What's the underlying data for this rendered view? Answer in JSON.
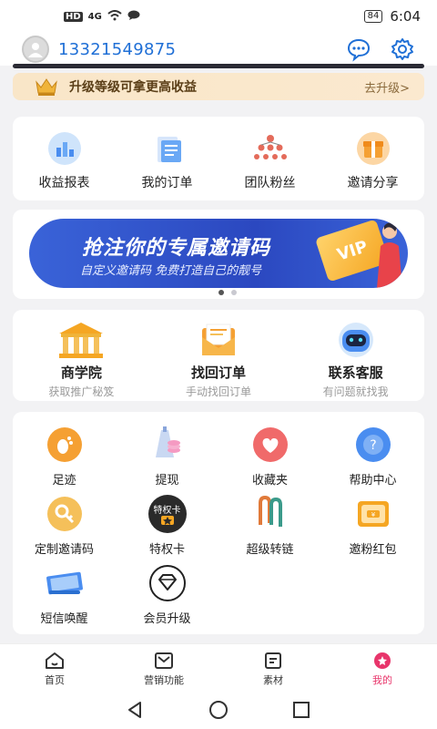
{
  "status_bar": {
    "left_icons": [
      "hd-icon",
      "4g-icon",
      "wifi-icon",
      "message-icon"
    ],
    "hd_text": "HD",
    "network_text": "4G",
    "battery": "84",
    "time": "6:04"
  },
  "header": {
    "phone": "13321549875",
    "icons": [
      "chat-icon",
      "settings-icon"
    ]
  },
  "upgrade_bar": {
    "text": "升级等级可拿更高收益",
    "action": "去升级>"
  },
  "quick_grid": {
    "items": [
      {
        "label": "收益报表",
        "icon": "report-icon"
      },
      {
        "label": "我的订单",
        "icon": "orders-icon"
      },
      {
        "label": "团队粉丝",
        "icon": "team-icon"
      },
      {
        "label": "邀请分享",
        "icon": "invite-gift-icon"
      }
    ]
  },
  "banner": {
    "title": "抢注你的专属邀请码",
    "subtitle": "自定义邀请码 免费打造自己的靓号",
    "badge": "VIP"
  },
  "services": {
    "items": [
      {
        "title": "商学院",
        "sub": "获取推广秘笈",
        "icon": "school-icon"
      },
      {
        "title": "找回订单",
        "sub": "手动找回订单",
        "icon": "envelope-icon"
      },
      {
        "title": "联系客服",
        "sub": "有问题就找我",
        "icon": "robot-icon"
      }
    ]
  },
  "tools": {
    "items": [
      {
        "label": "足迹",
        "icon": "footprint-icon",
        "color": "#f5a033"
      },
      {
        "label": "提现",
        "icon": "withdraw-icon",
        "color": "#a9c2ee"
      },
      {
        "label": "收藏夹",
        "icon": "favorites-icon",
        "color": "#f06a6a"
      },
      {
        "label": "帮助中心",
        "icon": "help-icon",
        "color": "#4a8df0"
      },
      {
        "label": "定制邀请码",
        "icon": "key-icon",
        "color": "#f5b13d"
      },
      {
        "label": "特权卡",
        "icon": "privilege-card-icon",
        "color": "#2a2a2a",
        "badge": "特权卡"
      },
      {
        "label": "超级转链",
        "icon": "paperclip-icon",
        "color": "#e07a3a"
      },
      {
        "label": "邀粉红包",
        "icon": "red-packet-icon",
        "color": "#f5a623"
      },
      {
        "label": "短信唤醒",
        "icon": "sms-icon",
        "color": "#4a8df0"
      },
      {
        "label": "会员升级",
        "icon": "diamond-icon",
        "color": "#222222"
      }
    ]
  },
  "tabbar": {
    "tabs": [
      {
        "label": "首页",
        "icon": "home-icon"
      },
      {
        "label": "营销功能",
        "icon": "marketing-icon"
      },
      {
        "label": "素材",
        "icon": "material-icon"
      },
      {
        "label": "我的",
        "icon": "mine-icon",
        "active": true
      }
    ],
    "active_color": "#e8356b"
  },
  "system_nav": [
    "back-icon",
    "home-circle-icon",
    "recents-icon"
  ]
}
